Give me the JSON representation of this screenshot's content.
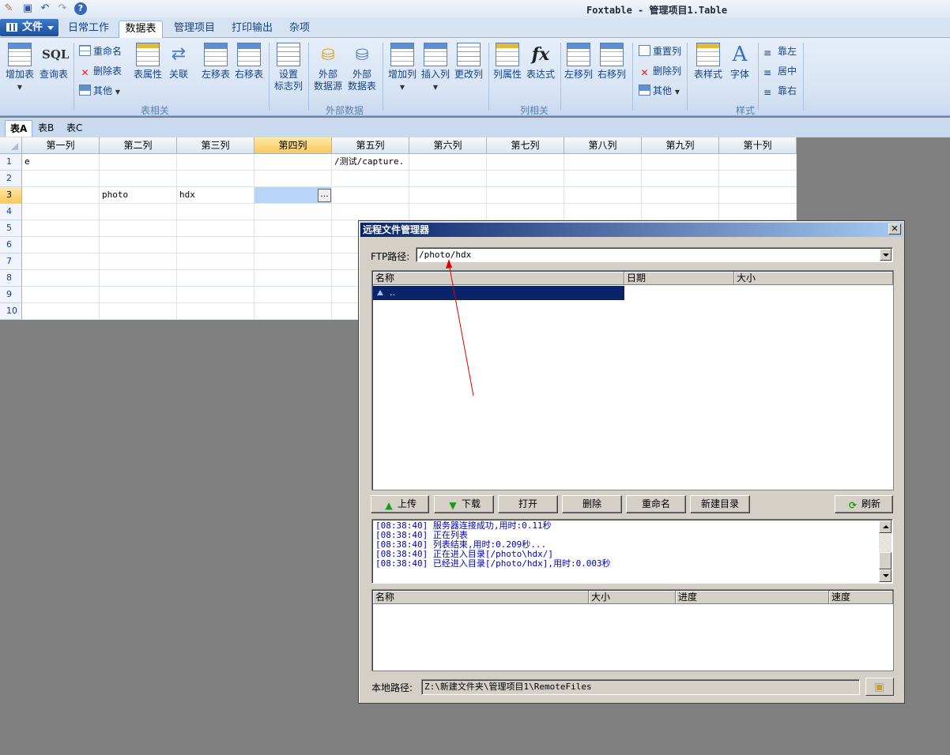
{
  "window": {
    "title": "Foxtable - 管理项目1.Table"
  },
  "quick_access": {
    "icons": [
      "app-icon",
      "save-icon",
      "undo-icon",
      "redo-icon",
      "help-icon"
    ]
  },
  "ribbon": {
    "file_menu": "文件",
    "tabs": [
      "日常工作",
      "数据表",
      "管理项目",
      "打印输出",
      "杂项"
    ],
    "active_tab": "数据表",
    "groups": {
      "table": {
        "label": "表相关",
        "add_table": "增加表",
        "query_table": "查询表",
        "sql_glyph": "SQL",
        "rename": "重命名",
        "delete_table": "删除表",
        "other": "其他",
        "table_props": "表属性",
        "relations": "关联",
        "move_left": "左移表",
        "move_right": "右移表",
        "set_flag_col_1": "设置",
        "set_flag_col_2": "标志列"
      },
      "external": {
        "label": "外部数据",
        "ext_source_1": "外部",
        "ext_source_2": "数据源",
        "ext_table_1": "外部",
        "ext_table_2": "数据表"
      },
      "columns": {
        "label": "列相关",
        "add_col": "增加列",
        "insert_col": "插入列",
        "edit_col": "更改列",
        "col_props": "列属性",
        "expression": "表达式",
        "fx_glyph": "fx",
        "col_left": "左移列",
        "col_right": "右移列",
        "reset_col": "重置列",
        "delete_col": "删除列",
        "other": "其他"
      },
      "style": {
        "label": "样式",
        "table_style": "表样式",
        "font": "字体",
        "align_left": "靠左",
        "align_center": "居中",
        "align_right": "靠右"
      }
    }
  },
  "sheet_tabs": [
    "表A",
    "表B",
    "表C"
  ],
  "active_sheet": "表A",
  "grid": {
    "columns": [
      "第一列",
      "第二列",
      "第三列",
      "第四列",
      "第五列",
      "第六列",
      "第七列",
      "第八列",
      "第九列",
      "第十列"
    ],
    "selected_column": "第四列",
    "row_numbers": [
      "1",
      "2",
      "3",
      "4",
      "5",
      "6",
      "7",
      "8",
      "9",
      "10"
    ],
    "selected_row": "3",
    "cells": {
      "r1c1": "e",
      "r1c5": "/测试/capture.",
      "r3c2": "photo",
      "r3c3": "hdx"
    },
    "cell_button": "..."
  },
  "dialog": {
    "title": "远程文件管理器",
    "close": "X",
    "ftp_label": "FTP路径:",
    "ftp_path": "/photo/hdx",
    "remote_headers": [
      "名称",
      "日期",
      "大小"
    ],
    "remote_rows": [
      {
        "name": ".."
      }
    ],
    "buttons": {
      "upload": "上传",
      "download": "下载",
      "open": "打开",
      "delete": "删除",
      "rename": "重命名",
      "new_dir": "新建目录",
      "refresh": "刷新"
    },
    "log": [
      "[08:38:40] 服务器连接成功,用时:0.11秒",
      "[08:38:40] 正在列表",
      "[08:38:40] 列表结束,用时:0.209秒...",
      "[08:38:40] 正在进入目录[/photo\\hdx/]",
      "[08:38:40] 已经进入目录[/photo/hdx],用时:0.003秒"
    ],
    "transfer_headers": [
      "名称",
      "大小",
      "进度",
      "速度"
    ],
    "local_label": "本地路径:",
    "local_path": "Z:\\新建文件夹\\管理项目1\\RemoteFiles"
  },
  "colors": {
    "accent": "#0a246a",
    "arrow": "#e00000",
    "ribbon_text": "#15428b",
    "log_text": "#0000c0",
    "selected_header": "#f9c95b"
  }
}
